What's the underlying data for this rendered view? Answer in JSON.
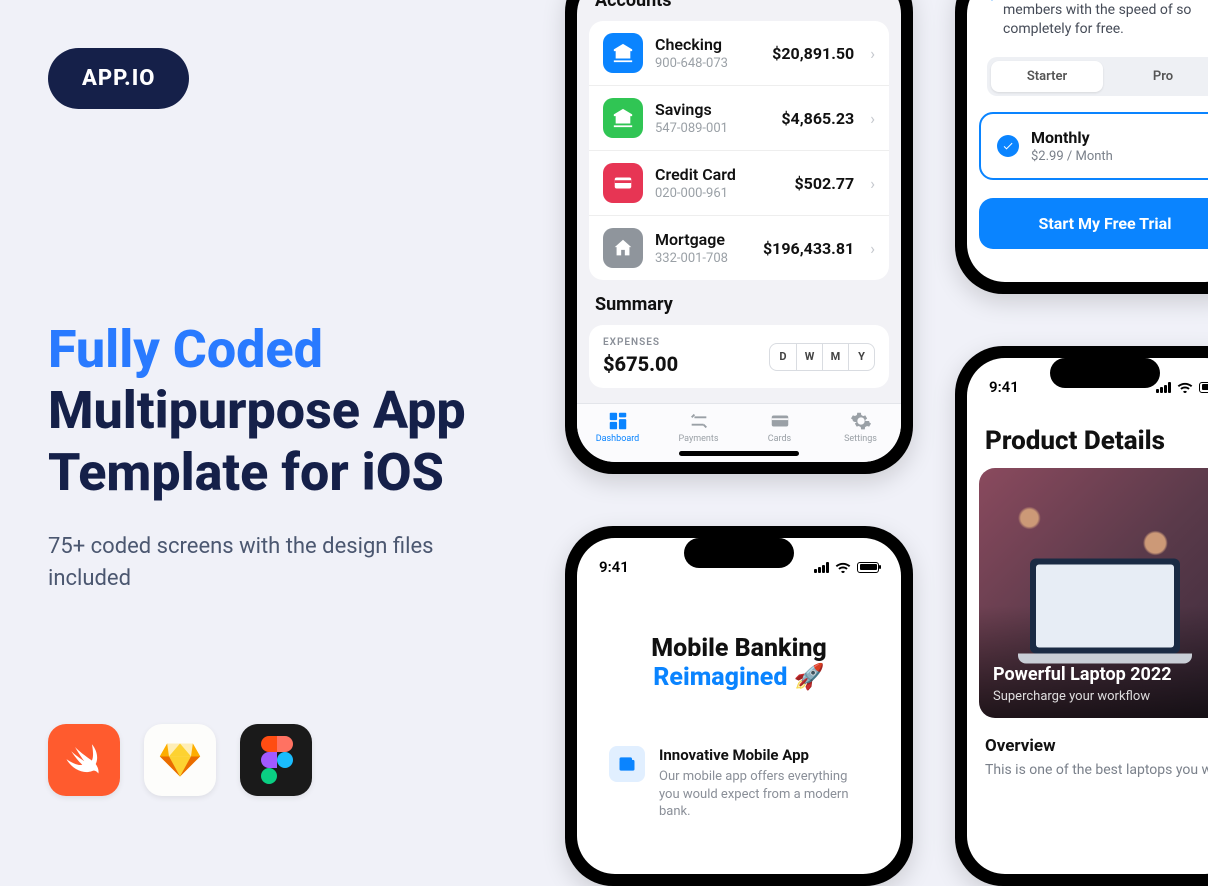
{
  "brand": "APP.IO",
  "headline_accent": "Fully Coded",
  "headline_rest": "Multipurpose App Template for iOS",
  "subtitle": "75+ coded screens with the design files included",
  "status_time": "9:41",
  "accounts": {
    "title": "Accounts",
    "items": [
      {
        "name": "Checking",
        "sub": "900-648-073",
        "amount": "$20,891.50",
        "color": "blue"
      },
      {
        "name": "Savings",
        "sub": "547-089-001",
        "amount": "$4,865.23",
        "color": "green"
      },
      {
        "name": "Credit Card",
        "sub": "020-000-961",
        "amount": "$502.77",
        "color": "red"
      },
      {
        "name": "Mortgage",
        "sub": "332-001-708",
        "amount": "$196,433.81",
        "color": "gray"
      }
    ],
    "summary_title": "Summary",
    "expenses_label": "EXPENSES",
    "expenses_value": "$675.00",
    "period": [
      "D",
      "W",
      "M",
      "Y"
    ],
    "tabs": [
      "Dashboard",
      "Payments",
      "Cards",
      "Settings"
    ]
  },
  "pricing": {
    "blurb": "Transfer money to friends and members with the speed of so completely for free.",
    "tiers": [
      "Starter",
      "Pro"
    ],
    "plan_name": "Monthly",
    "plan_price": "$2.99 / Month",
    "cta": "Start My Free Trial"
  },
  "banking": {
    "title_a": "Mobile Banking",
    "title_b": "Reimagined 🚀",
    "card_title": "Innovative Mobile App",
    "card_desc": "Our mobile app offers everything you would expect from a modern bank."
  },
  "product": {
    "title": "Product Details",
    "hero_title": "Powerful Laptop 2022",
    "hero_sub": "Supercharge your workflow",
    "overview": "Overview",
    "overview_desc": "This is one of the best laptops you w"
  }
}
